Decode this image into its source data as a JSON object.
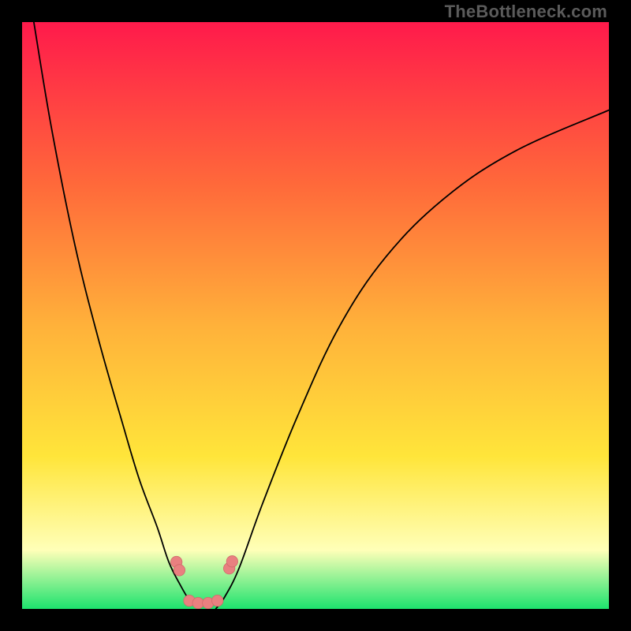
{
  "watermark": "TheBottleneck.com",
  "colors": {
    "frame": "#000000",
    "watermark_text": "#5b5b5b",
    "gradient_top": "#ff1a4b",
    "gradient_mid1": "#ff6a3a",
    "gradient_mid2": "#ffb23a",
    "gradient_mid3": "#ffe53a",
    "gradient_pale": "#ffffb8",
    "gradient_bottom": "#1de36e",
    "curve_stroke": "#000000",
    "marker_fill": "#e98080",
    "marker_stroke": "#d06a6a"
  },
  "chart_data": {
    "type": "line",
    "title": "",
    "xlabel": "",
    "ylabel": "",
    "xlim": [
      0,
      100
    ],
    "ylim": [
      0,
      100
    ],
    "series": [
      {
        "name": "left-curve",
        "x": [
          2,
          5,
          9,
          13,
          17,
          20,
          23,
          25,
          27,
          28.5,
          30
        ],
        "y": [
          100,
          82,
          62,
          46,
          32,
          22,
          14,
          8,
          4,
          1.5,
          0
        ]
      },
      {
        "name": "right-curve",
        "x": [
          33,
          34.5,
          37,
          41,
          47,
          54,
          62,
          72,
          84,
          100
        ],
        "y": [
          0,
          2,
          7,
          18,
          33,
          48,
          60,
          70,
          78,
          85
        ]
      }
    ],
    "markers": [
      {
        "name": "left-cluster-a",
        "x": 26.3,
        "y": 8
      },
      {
        "name": "left-cluster-b",
        "x": 26.8,
        "y": 6.6
      },
      {
        "name": "floor-a",
        "x": 28.5,
        "y": 1.4
      },
      {
        "name": "floor-b",
        "x": 30.0,
        "y": 1.0
      },
      {
        "name": "floor-c",
        "x": 31.7,
        "y": 1.0
      },
      {
        "name": "floor-d",
        "x": 33.3,
        "y": 1.4
      },
      {
        "name": "right-cluster-a",
        "x": 35.3,
        "y": 6.9
      },
      {
        "name": "right-cluster-b",
        "x": 35.8,
        "y": 8.1
      }
    ]
  }
}
